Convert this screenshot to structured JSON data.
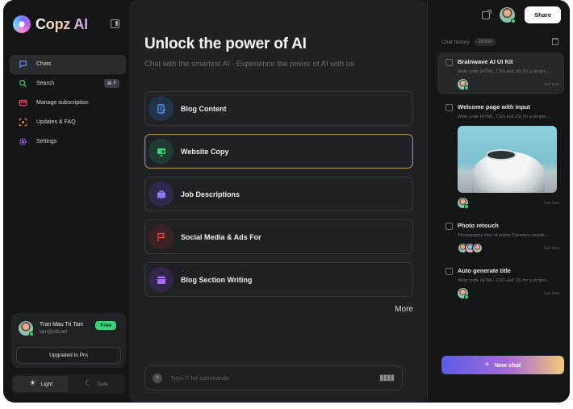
{
  "brand": {
    "name": "Copz AI"
  },
  "sidebar": {
    "items": [
      {
        "label": "Chats",
        "icon": "chat-icon",
        "color": "#6c8cff",
        "active": true
      },
      {
        "label": "Search",
        "icon": "search-icon",
        "color": "#3fd07a",
        "shortcut": "⌘ F"
      },
      {
        "label": "Manage subscription",
        "icon": "card-icon",
        "color": "#e05a7a"
      },
      {
        "label": "Updates & FAQ",
        "icon": "lightbulb-icon",
        "color": "#f08a3c"
      },
      {
        "label": "Settings",
        "icon": "gear-icon",
        "color": "#a86cf0"
      }
    ]
  },
  "user": {
    "name": "Tran Mau Tri Tam",
    "email": "tam@ui8.net",
    "plan_badge": "Free",
    "upgrade_label": "Upgraded to Pro"
  },
  "theme": {
    "light_label": "Light",
    "dark_label": "Dark",
    "selected": "Light"
  },
  "main": {
    "title": "Unlock the power of AI",
    "subtitle": "Chat with the smartest AI - Experience the power of AI with us",
    "prompts": [
      {
        "label": "Blog Content",
        "icon": "document-edit-icon",
        "bg": "#23344a",
        "fg": "#4f8ff0"
      },
      {
        "label": "Website Copy",
        "icon": "monitor-icon",
        "bg": "#1f3b32",
        "fg": "#3fd07a",
        "active": true
      },
      {
        "label": "Job Descriptions",
        "icon": "briefcase-icon",
        "bg": "#2c2a4a",
        "fg": "#8a7cf0"
      },
      {
        "label": "Social Media & Ads For",
        "icon": "flag-icon",
        "bg": "#3c2124",
        "fg": "#e0443c"
      },
      {
        "label": "Blog Section Writing",
        "icon": "calendar-icon",
        "bg": "#34264a",
        "fg": "#a86cf0"
      }
    ],
    "more_label": "More",
    "composer_placeholder": "Type '/' for commands"
  },
  "header": {
    "share_label": "Share"
  },
  "history": {
    "title": "Chat history",
    "count": "26/100",
    "items": [
      {
        "title": "Brainwave AI UI Kit",
        "desc": "Write code (HTML, CSS and JS) for a simple...",
        "time": "Just now",
        "selected": true,
        "avatars": 1
      },
      {
        "title": "Welcome page with input",
        "desc": "Write code (HTML, CSS and JS) for a simple...",
        "time": "Just now",
        "image": true,
        "avatars": 1
      },
      {
        "title": "Photo retouch",
        "desc": "Photography shot of anime Travelers couple...",
        "time": "Just now",
        "avatars": 3
      },
      {
        "title": "Auto generate title",
        "desc": "Write code (HTML, CSS and JS) for a simple...",
        "time": "Just now",
        "avatars": 1
      }
    ],
    "new_chat_label": "New chat"
  },
  "colors": {
    "accent": "#6c5ce7",
    "background": "#141517",
    "panel": "#202124",
    "online": "#3ad070"
  }
}
